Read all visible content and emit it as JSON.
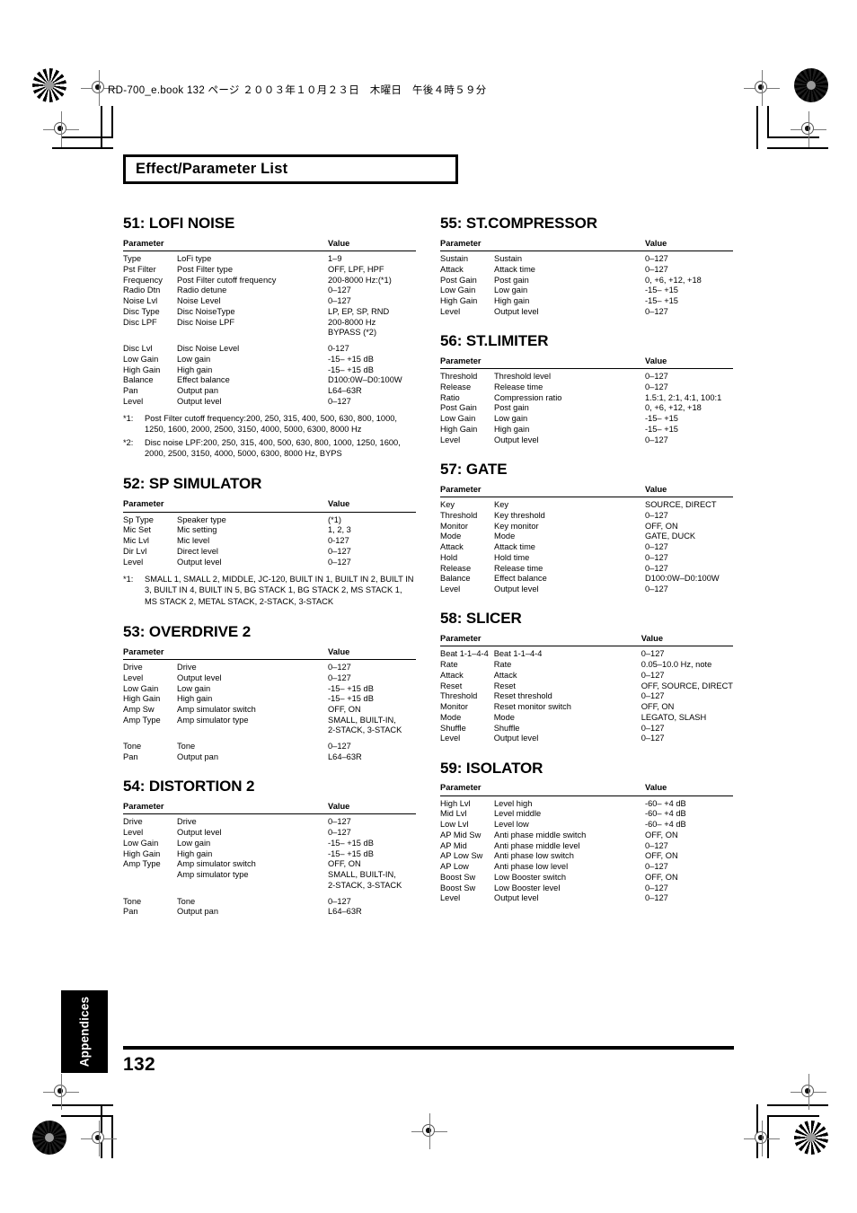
{
  "header": {
    "filename_line": "RD-700_e.book 132 ページ ２００３年１０月２３日　木曜日　午後４時５９分"
  },
  "chapter": {
    "title": "Effect/Parameter List"
  },
  "table_headers": {
    "parameter": "Parameter",
    "value": "Value"
  },
  "sections": {
    "lofi_noise": {
      "title": "51: LOFI NOISE",
      "rows": [
        {
          "param": "Type",
          "desc": "LoFi type",
          "value": "1–9"
        },
        {
          "param": "Pst Filter",
          "desc": "Post Filter type",
          "value": "OFF, LPF, HPF"
        },
        {
          "param": "Frequency",
          "desc": "Post Filter cutoff frequency",
          "value": "200-8000 Hz:(*1)"
        },
        {
          "param": "Radio Dtn",
          "desc": "Radio detune",
          "value": "0–127"
        },
        {
          "param": "Noise Lvl",
          "desc": "Noise Level",
          "value": "0–127"
        },
        {
          "param": "Disc Type",
          "desc": "Disc NoiseType",
          "value": "LP, EP, SP, RND"
        },
        {
          "param": "Disc LPF",
          "desc": "Disc Noise LPF",
          "value": "200-8000 Hz"
        },
        {
          "param": "",
          "desc": "",
          "value": "BYPASS (*2)",
          "cont": true
        },
        {
          "param": "Disc Lvl",
          "desc": "Disc Noise Level",
          "value": "0-127",
          "gap": true
        },
        {
          "param": "Low Gain",
          "desc": "Low gain",
          "value": "-15– +15 dB"
        },
        {
          "param": "High Gain",
          "desc": "High gain",
          "value": "-15– +15 dB"
        },
        {
          "param": "Balance",
          "desc": "Effect balance",
          "value": "D100:0W–D0:100W"
        },
        {
          "param": "Pan",
          "desc": "Output pan",
          "value": "L64–63R"
        },
        {
          "param": "Level",
          "desc": "Output level",
          "value": "0–127"
        }
      ],
      "notes": [
        {
          "mark": "*1:",
          "text": "Post Filter cutoff frequency:200, 250, 315, 400, 500, 630, 800, 1000, 1250, 1600, 2000, 2500, 3150, 4000, 5000, 6300, 8000 Hz"
        },
        {
          "mark": "*2:",
          "text": "Disc noise LPF:200, 250, 315, 400, 500, 630, 800, 1000, 1250, 1600, 2000, 2500, 3150, 4000, 5000, 6300, 8000 Hz, BYPS"
        }
      ]
    },
    "sp_simulator": {
      "title": "52: SP SIMULATOR",
      "rows": [
        {
          "param": "Sp Type",
          "desc": "Speaker type",
          "value": "(*1)"
        },
        {
          "param": "Mic Set",
          "desc": "Mic setting",
          "value": "1, 2, 3"
        },
        {
          "param": "Mic Lvl",
          "desc": "Mic level",
          "value": "0-127"
        },
        {
          "param": "Dir Lvl",
          "desc": "Direct level",
          "value": "0–127"
        },
        {
          "param": "Level",
          "desc": "Output level",
          "value": "0–127"
        }
      ],
      "notes": [
        {
          "mark": "*1:",
          "text": "SMALL 1, SMALL 2, MIDDLE, JC-120, BUILT IN 1, BUILT IN 2, BUILT IN 3, BUILT IN 4, BUILT IN 5, BG STACK 1, BG STACK 2, MS STACK 1, MS STACK 2, METAL STACK, 2-STACK, 3-STACK"
        }
      ]
    },
    "overdrive_2": {
      "title": "53: OVERDRIVE 2",
      "rows": [
        {
          "param": "Drive",
          "desc": "Drive",
          "value": "0–127"
        },
        {
          "param": "Level",
          "desc": "Output level",
          "value": "0–127"
        },
        {
          "param": "Low Gain",
          "desc": "Low gain",
          "value": "-15– +15 dB"
        },
        {
          "param": "High Gain",
          "desc": "High gain",
          "value": "-15– +15 dB"
        },
        {
          "param": "Amp Sw",
          "desc": "Amp simulator switch",
          "value": "OFF, ON"
        },
        {
          "param": "Amp Type",
          "desc": "Amp simulator type",
          "value": "SMALL, BUILT-IN,"
        },
        {
          "param": "",
          "desc": "",
          "value": "2-STACK, 3-STACK",
          "cont": true
        },
        {
          "param": "Tone",
          "desc": "Tone",
          "value": "0–127",
          "gap": true
        },
        {
          "param": "Pan",
          "desc": "Output pan",
          "value": "L64–63R"
        }
      ],
      "notes": []
    },
    "distortion_2": {
      "title": "54: DISTORTION 2",
      "rows": [
        {
          "param": "Drive",
          "desc": "Drive",
          "value": "0–127"
        },
        {
          "param": "Level",
          "desc": "Output level",
          "value": "0–127"
        },
        {
          "param": "Low Gain",
          "desc": "Low gain",
          "value": "-15– +15 dB"
        },
        {
          "param": "High Gain",
          "desc": "High gain",
          "value": "-15– +15 dB"
        },
        {
          "param": "Amp Type",
          "desc": "Amp simulator switch",
          "value": "OFF, ON"
        },
        {
          "param": "",
          "desc": "Amp simulator type",
          "value": "SMALL, BUILT-IN,"
        },
        {
          "param": "",
          "desc": "",
          "value": "2-STACK, 3-STACK",
          "cont": true
        },
        {
          "param": "Tone",
          "desc": "Tone",
          "value": "0–127",
          "gap": true
        },
        {
          "param": "Pan",
          "desc": "Output pan",
          "value": "L64–63R"
        }
      ],
      "notes": []
    },
    "st_compressor": {
      "title": "55: ST.COMPRESSOR",
      "rows": [
        {
          "param": "Sustain",
          "desc": "Sustain",
          "value": "0–127"
        },
        {
          "param": "Attack",
          "desc": "Attack time",
          "value": "0–127"
        },
        {
          "param": "Post Gain",
          "desc": "Post gain",
          "value": "0, +6, +12, +18"
        },
        {
          "param": "Low Gain",
          "desc": "Low gain",
          "value": "-15– +15"
        },
        {
          "param": "High Gain",
          "desc": "High gain",
          "value": "-15– +15"
        },
        {
          "param": "Level",
          "desc": "Output level",
          "value": "0–127"
        }
      ],
      "notes": []
    },
    "st_limiter": {
      "title": "56: ST.LIMITER",
      "rows": [
        {
          "param": "Threshold",
          "desc": "Threshold level",
          "value": "0–127"
        },
        {
          "param": "Release",
          "desc": "Release time",
          "value": "0–127"
        },
        {
          "param": "Ratio",
          "desc": "Compression ratio",
          "value": "1.5:1, 2:1, 4:1, 100:1"
        },
        {
          "param": "Post Gain",
          "desc": "Post gain",
          "value": "0, +6, +12, +18"
        },
        {
          "param": "Low Gain",
          "desc": "Low gain",
          "value": "-15– +15"
        },
        {
          "param": "High Gain",
          "desc": "High gain",
          "value": "-15– +15"
        },
        {
          "param": "Level",
          "desc": "Output level",
          "value": "0–127"
        }
      ],
      "notes": []
    },
    "gate": {
      "title": "57: GATE",
      "rows": [
        {
          "param": "Key",
          "desc": "Key",
          "value": "SOURCE, DIRECT"
        },
        {
          "param": "Threshold",
          "desc": "Key threshold",
          "value": "0–127"
        },
        {
          "param": "Monitor",
          "desc": "Key monitor",
          "value": "OFF, ON"
        },
        {
          "param": "Mode",
          "desc": "Mode",
          "value": "GATE, DUCK"
        },
        {
          "param": "Attack",
          "desc": "Attack time",
          "value": "0–127"
        },
        {
          "param": "Hold",
          "desc": "Hold time",
          "value": "0–127"
        },
        {
          "param": "Release",
          "desc": "Release time",
          "value": "0–127"
        },
        {
          "param": "Balance",
          "desc": "Effect balance",
          "value": "D100:0W–D0:100W"
        },
        {
          "param": "Level",
          "desc": "Output level",
          "value": "0–127"
        }
      ],
      "notes": []
    },
    "slicer": {
      "title": "58: SLICER",
      "rows": [
        {
          "param": "Beat 1-1–4-4",
          "desc": "Beat 1-1–4-4",
          "value": "0–127"
        },
        {
          "param": "Rate",
          "desc": "Rate",
          "value": "0.05–10.0 Hz, note"
        },
        {
          "param": "Attack",
          "desc": "Attack",
          "value": "0–127"
        },
        {
          "param": "Reset",
          "desc": "Reset",
          "value": "OFF, SOURCE, DIRECT"
        },
        {
          "param": "Threshold",
          "desc": "Reset threshold",
          "value": "0–127"
        },
        {
          "param": "Monitor",
          "desc": "Reset monitor switch",
          "value": "OFF, ON"
        },
        {
          "param": "Mode",
          "desc": "Mode",
          "value": "LEGATO, SLASH"
        },
        {
          "param": "Shuffle",
          "desc": "Shuffle",
          "value": "0–127"
        },
        {
          "param": "Level",
          "desc": "Output level",
          "value": "0–127"
        }
      ],
      "notes": []
    },
    "isolator": {
      "title": "59: ISOLATOR",
      "rows": [
        {
          "param": "High Lvl",
          "desc": "Level high",
          "value": "-60– +4 dB"
        },
        {
          "param": "Mid Lvl",
          "desc": "Level middle",
          "value": "-60– +4 dB"
        },
        {
          "param": "Low Lvl",
          "desc": "Level low",
          "value": "-60– +4 dB"
        },
        {
          "param": "AP Mid Sw",
          "desc": "Anti phase middle switch",
          "value": "OFF, ON"
        },
        {
          "param": "AP Mid",
          "desc": "Anti phase middle level",
          "value": "0–127"
        },
        {
          "param": "AP Low Sw",
          "desc": "Anti phase low switch",
          "value": "OFF, ON"
        },
        {
          "param": "AP Low",
          "desc": "Anti phase low level",
          "value": "0–127"
        },
        {
          "param": "Boost Sw",
          "desc": "Low Booster switch",
          "value": "OFF, ON"
        },
        {
          "param": "Boost Sw",
          "desc": "Low Booster level",
          "value": "0–127"
        },
        {
          "param": "Level",
          "desc": "Output level",
          "value": "0–127"
        }
      ],
      "notes": []
    }
  },
  "footer": {
    "tab_label": "Appendices",
    "page_number": "132"
  }
}
